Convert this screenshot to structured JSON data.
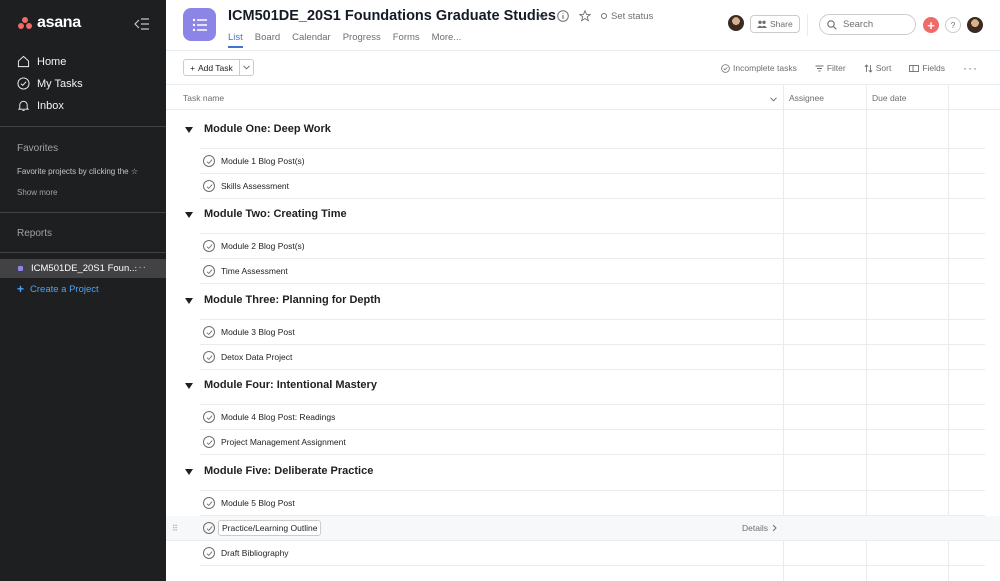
{
  "sidebar": {
    "logo": "asana",
    "nav": [
      {
        "label": "Home",
        "icon": "home-icon"
      },
      {
        "label": "My Tasks",
        "icon": "check-circle-icon"
      },
      {
        "label": "Inbox",
        "icon": "bell-icon"
      }
    ],
    "favorites_title": "Favorites",
    "favorites_hint": "Favorite projects by clicking the ☆",
    "show_more": "Show more",
    "reports_title": "Reports",
    "project_label": "ICM501DE_20S1 Foun...",
    "create_project": "Create a Project"
  },
  "header": {
    "title": "ICM501DE_20S1 Foundations Graduate Studies",
    "set_status": "Set status",
    "tabs": [
      "List",
      "Board",
      "Calendar",
      "Progress",
      "Forms",
      "More..."
    ],
    "share": "Share",
    "search_placeholder": "Search",
    "help": "?"
  },
  "toolbar": {
    "add_task": "Add Task",
    "incomplete": "Incomplete tasks",
    "filter": "Filter",
    "sort": "Sort",
    "fields": "Fields"
  },
  "columns": {
    "task_name": "Task name",
    "assignee": "Assignee",
    "due_date": "Due date"
  },
  "sections": [
    {
      "name": "Module One: Deep Work",
      "tasks": [
        "Module 1 Blog Post(s)",
        "Skills Assessment"
      ]
    },
    {
      "name": "Module Two: Creating Time",
      "tasks": [
        "Module 2 Blog Post(s)",
        "Time Assessment"
      ]
    },
    {
      "name": "Module Three: Planning for Depth",
      "tasks": [
        "Module 3 Blog Post",
        "Detox Data Project"
      ]
    },
    {
      "name": "Module Four: Intentional Mastery",
      "tasks": [
        "Module 4 Blog Post: Readings",
        "Project Management Assignment"
      ]
    },
    {
      "name": "Module Five: Deliberate Practice",
      "tasks": [
        "Module 5 Blog Post",
        "Practice/Learning Outline",
        "Draft Bibliography"
      ]
    }
  ],
  "details_label": "Details",
  "colors": {
    "sidebar_bg": "#1e1f21",
    "accent_blue": "#4573d2",
    "project_purple": "#8d84e8",
    "add_red": "#f06a6a"
  }
}
